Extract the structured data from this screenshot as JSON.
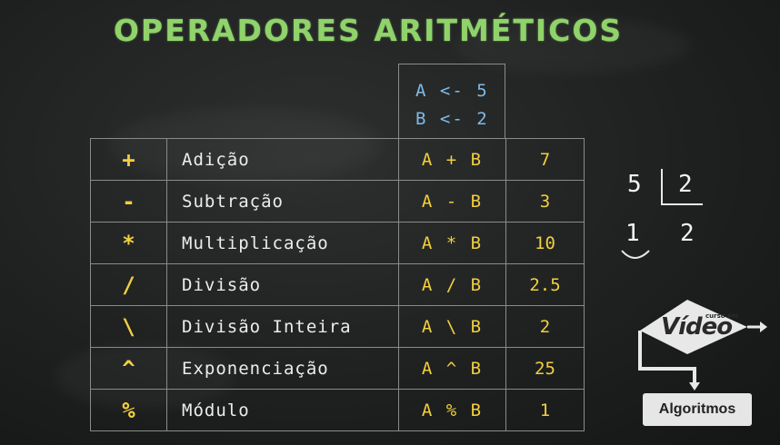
{
  "title": "OPERADORES ARITMÉTICOS",
  "assignments": [
    "A <- 5",
    "B <- 2"
  ],
  "operators": [
    {
      "symbol": "+",
      "name": "Adição",
      "expression": "A + B",
      "result": "7"
    },
    {
      "symbol": "-",
      "name": "Subtração",
      "expression": "A - B",
      "result": "3"
    },
    {
      "symbol": "*",
      "name": "Multiplicação",
      "expression": "A * B",
      "result": "10"
    },
    {
      "symbol": "/",
      "name": "Divisão",
      "expression": "A / B",
      "result": "2.5"
    },
    {
      "symbol": "\\",
      "name": "Divisão Inteira",
      "expression": "A \\ B",
      "result": "2"
    },
    {
      "symbol": "^",
      "name": "Exponenciação",
      "expression": "A ^ B",
      "result": "25"
    },
    {
      "symbol": "%",
      "name": "Módulo",
      "expression": "A % B",
      "result": "1"
    }
  ],
  "long_division": {
    "dividend": "5",
    "divisor": "2",
    "remainder": "1",
    "quotient": "2"
  },
  "logo": {
    "small_text": "curso em",
    "main_text": "Vídeo",
    "badge": "Algoritmos"
  },
  "colors": {
    "title": "#8fd36a",
    "assign": "#7fbbe8",
    "symbol": "#f2cf3e",
    "text": "#ececec",
    "board": "#222424"
  }
}
